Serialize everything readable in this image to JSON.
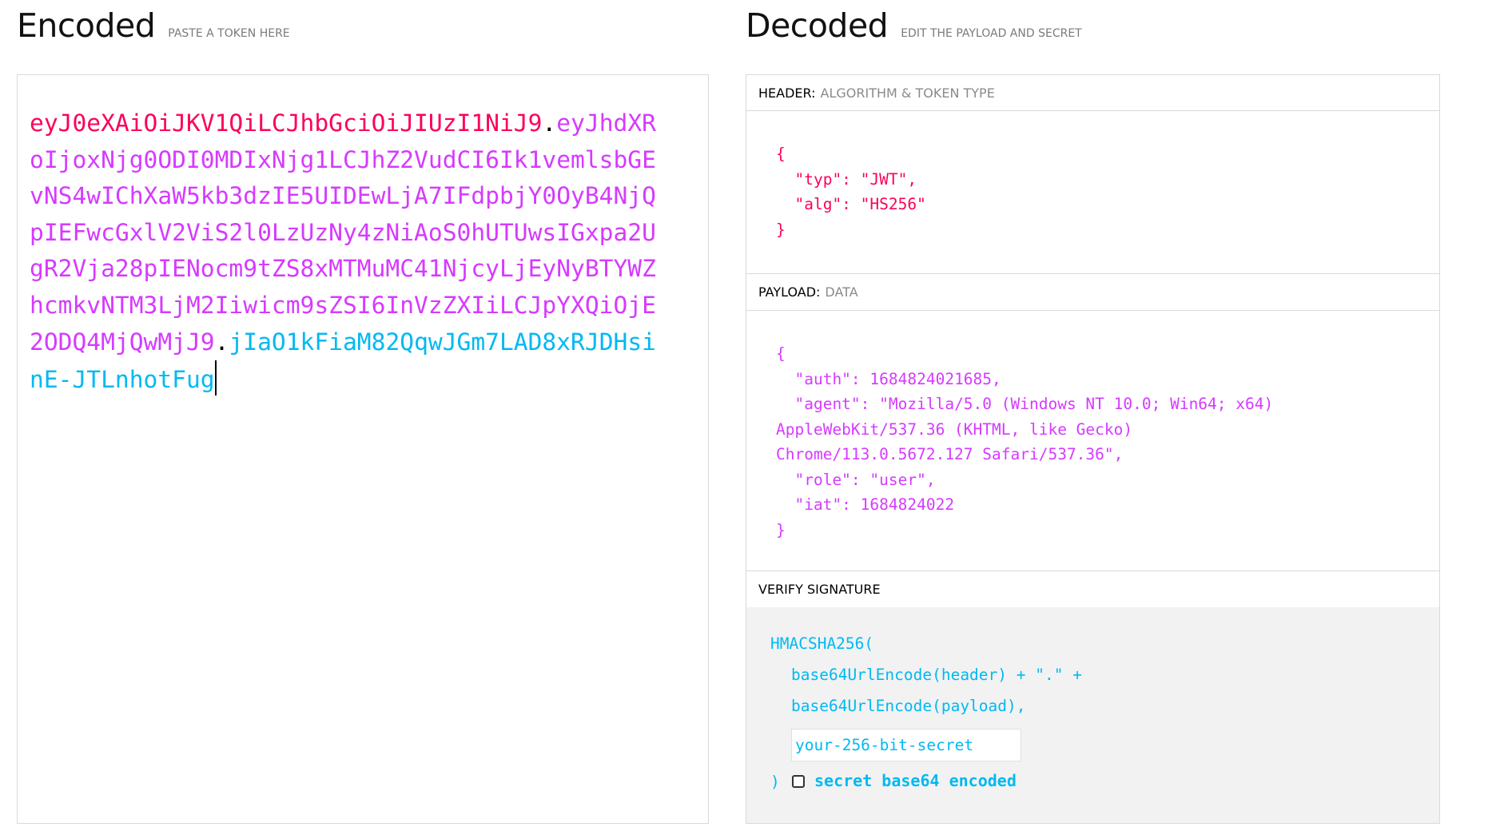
{
  "encoded": {
    "title": "Encoded",
    "hint": "PASTE A TOKEN HERE",
    "token": {
      "header": "eyJ0eXAiOiJKV1QiLCJhbGciOiJIUzI1NiJ9",
      "dot1": ".",
      "payload": "eyJhdXRoIjoxNjg0ODI0MDIxNjg1LCJhZ2VudCI6Ik1vemlsbGEvNS4wIChXaW5kb3dzIE5UIDEwLjA7IFdpbjY0OyB4NjQpIEFwcGxlV2ViS2l0LzUzNy4zNiAoS0hUTUwsIGxpa2UgR2Vja28pIENocm9tZS8xMTMuMC41NjcyLjEyNyBTYWZhcmkvNTM3LjM2Iiwicm9sZSI6InVzZXIiLCJpYXQiOjE2ODQ4MjQwMjJ9",
      "dot2": ".",
      "signature": "jIaO1kFiaM82QqwJGm7LAD8xRJDHsinE-JTLnhotFug"
    }
  },
  "decoded": {
    "title": "Decoded",
    "hint": "EDIT THE PAYLOAD AND SECRET",
    "header_section": {
      "label": "HEADER:",
      "sublabel": "ALGORITHM & TOKEN TYPE",
      "json": "{\n  \"typ\": \"JWT\",\n  \"alg\": \"HS256\"\n}"
    },
    "payload_section": {
      "label": "PAYLOAD:",
      "sublabel": "DATA",
      "json": "{\n  \"auth\": 1684824021685,\n  \"agent\": \"Mozilla/5.0 (Windows NT 10.0; Win64; x64)\nAppleWebKit/537.36 (KHTML, like Gecko)\nChrome/113.0.5672.127 Safari/537.36\",\n  \"role\": \"user\",\n  \"iat\": 1684824022\n}"
    },
    "verify_section": {
      "label": "VERIFY SIGNATURE",
      "line1": "HMACSHA256(",
      "line2": "base64UrlEncode(header) + \".\" +",
      "line3": "base64UrlEncode(payload),",
      "secret_placeholder": "your-256-bit-secret",
      "close_paren": ")",
      "checkbox_label": "secret base64 encoded",
      "checkbox_checked": false
    }
  },
  "colors": {
    "header": "#fb015b",
    "payload": "#d63aff",
    "signature": "#00b9f1"
  }
}
